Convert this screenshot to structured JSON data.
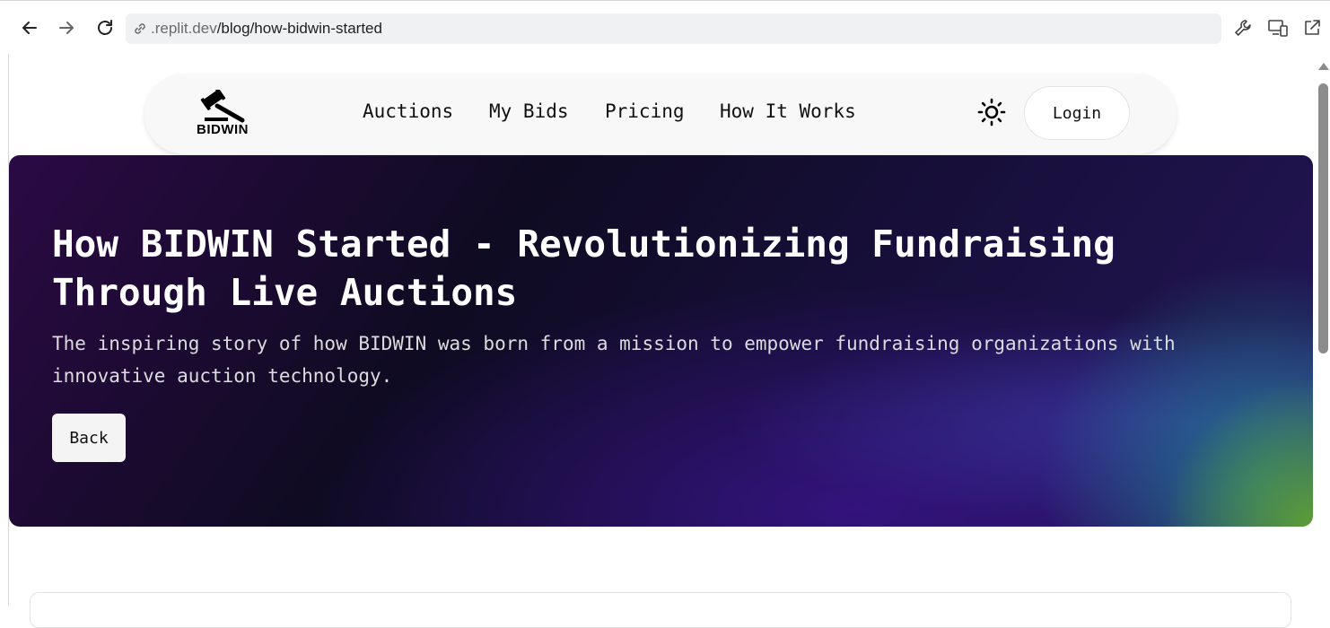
{
  "browser": {
    "url_muted": ".replit.dev",
    "url_path": "/blog/how-bidwin-started",
    "icons": [
      "back-arrow-icon",
      "forward-arrow-icon",
      "reload-icon",
      "link-icon",
      "wrench-icon",
      "devices-icon",
      "open-external-icon"
    ]
  },
  "nav": {
    "logo_text": "BIDWIN",
    "logo_icon": "gavel-icon",
    "menu": [
      "Auctions",
      "My Bids",
      "Pricing",
      "How It Works"
    ],
    "theme_icon": "sun-icon",
    "login_label": "Login"
  },
  "hero": {
    "title_line1": "How BIDWIN Started - Revolutionizing Fundraising",
    "title_line2": "Through Live Auctions",
    "subtitle_line1": "The inspiring story of how BIDWIN was born from a mission to empower fundraising organizations with",
    "subtitle_line2": "innovative auction technology.",
    "back_label": "Back"
  },
  "colors": {
    "hero_dark": "#0f0b22",
    "hero_purple": "#2b0a44",
    "hero_accent_green": "#5f9e36",
    "nav_bg": "#f8f8f8"
  }
}
